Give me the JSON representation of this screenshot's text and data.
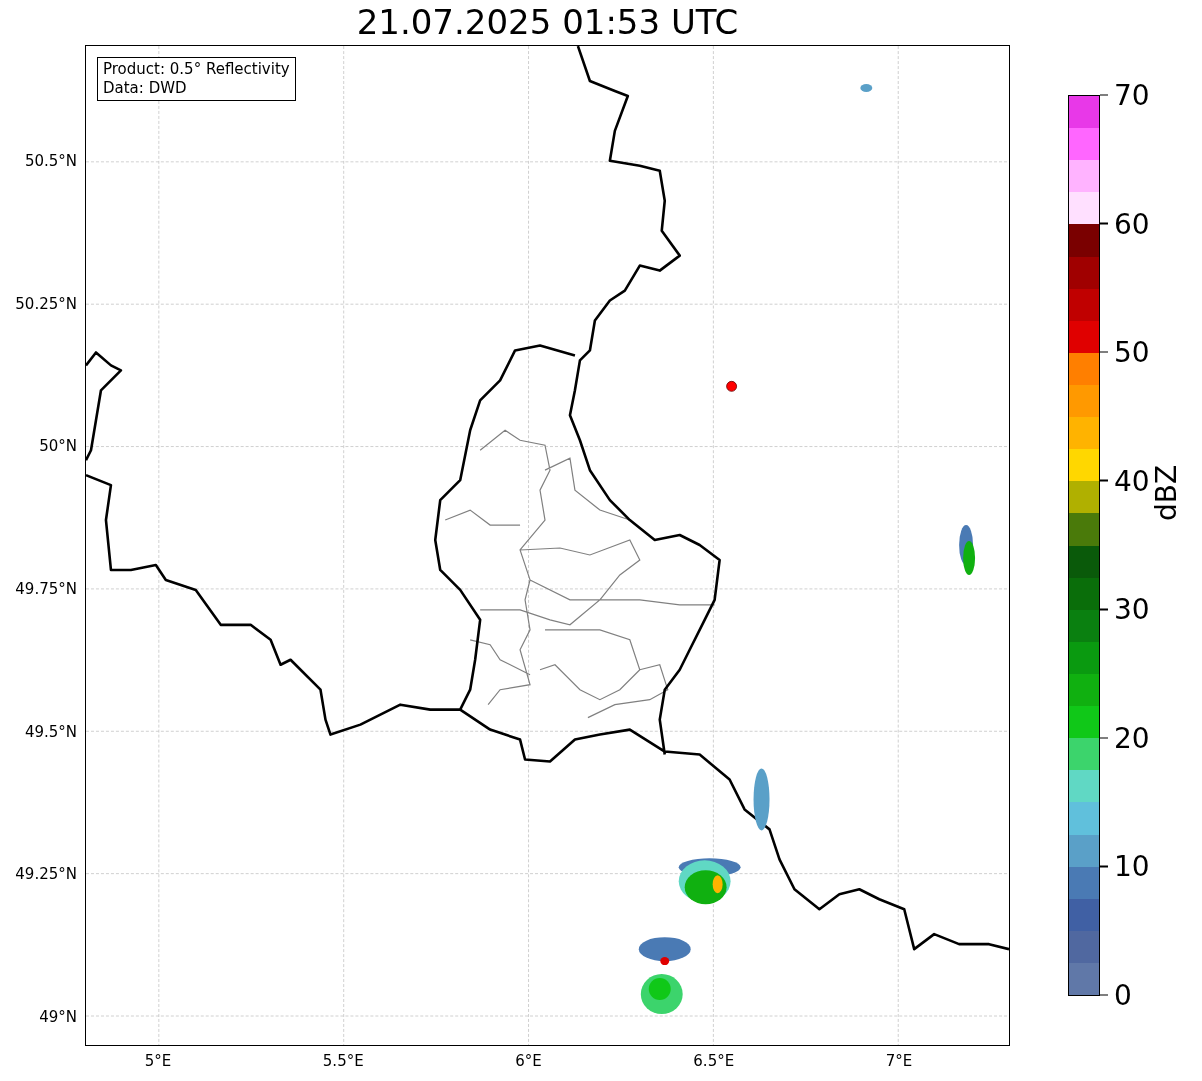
{
  "title": "21.07.2025 01:53 UTC",
  "info_box": [
    "Product: 0.5° Reflectivity",
    "Data: DWD"
  ],
  "map": {
    "y_ticks": [
      "50.5°N",
      "50.25°N",
      "50°N",
      "49.75°N",
      "49.5°N",
      "49.25°N",
      "49°N"
    ],
    "x_ticks": [
      "5°E",
      "5.5°E",
      "6°E",
      "6.5°E",
      "7°E"
    ]
  },
  "colorbar": {
    "label": "dBZ",
    "ticks": [
      "70",
      "60",
      "50",
      "40",
      "30",
      "20",
      "10",
      "0"
    ],
    "bins": [
      {
        "color": "#e838e8"
      },
      {
        "color": "#ff66ff"
      },
      {
        "color": "#ffb3ff"
      },
      {
        "color": "#ffe0ff"
      },
      {
        "color": "#7a0000"
      },
      {
        "color": "#a00000"
      },
      {
        "color": "#c00000"
      },
      {
        "color": "#e00000"
      },
      {
        "color": "#ff7f00"
      },
      {
        "color": "#ff9900"
      },
      {
        "color": "#ffb300"
      },
      {
        "color": "#ffd700"
      },
      {
        "color": "#b0b000"
      },
      {
        "color": "#4a7a0a"
      },
      {
        "color": "#0a5a0a"
      },
      {
        "color": "#0a6e0a"
      },
      {
        "color": "#0a8010"
      },
      {
        "color": "#0a9a10"
      },
      {
        "color": "#10b010"
      },
      {
        "color": "#10c818"
      },
      {
        "color": "#3cd46c"
      },
      {
        "color": "#60d8c4"
      },
      {
        "color": "#60c0dc"
      },
      {
        "color": "#5aa0c8"
      },
      {
        "color": "#4a7ab4"
      },
      {
        "color": "#4060a4"
      },
      {
        "color": "#5068a0"
      },
      {
        "color": "#6078a8"
      }
    ]
  }
}
